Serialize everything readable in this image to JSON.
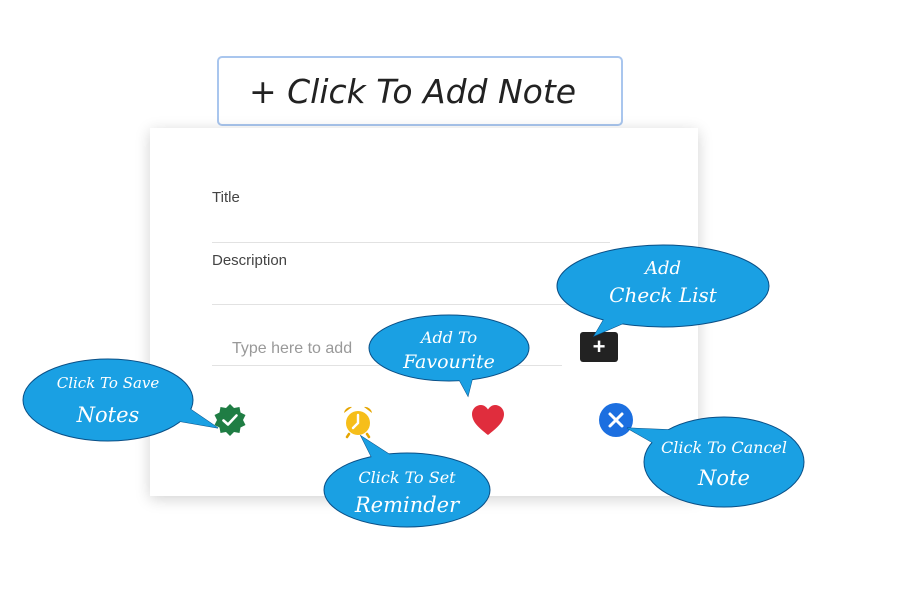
{
  "add_note": {
    "label": "+ Click To Add Note"
  },
  "form": {
    "title_label": "Title",
    "description_label": "Description",
    "checklist_placeholder": "Type here to add",
    "add_checklist_symbol": "+"
  },
  "actions": [
    {
      "name": "save",
      "icon": "check-badge-icon",
      "color": "#1f7d44"
    },
    {
      "name": "reminder",
      "icon": "alarm-clock-icon",
      "color": "#f6be1a"
    },
    {
      "name": "favourite",
      "icon": "heart-icon",
      "color": "#e02d3d"
    },
    {
      "name": "cancel",
      "icon": "close-circle-icon",
      "color": "#1c6fe0"
    }
  ],
  "callouts": {
    "add_checklist": {
      "line1": "Add",
      "line2": "Check List"
    },
    "favourite": {
      "line1": "Add To",
      "line2": "Favourite"
    },
    "save": {
      "line1": "Click To Save",
      "line2": "Notes"
    },
    "reminder": {
      "line1": "Click To Set",
      "line2": "Reminder"
    },
    "cancel": {
      "line1": "Click To Cancel",
      "line2": "Note"
    }
  },
  "colors": {
    "callout_fill": "#1aa0e3",
    "callout_stroke": "#0a4f86"
  }
}
